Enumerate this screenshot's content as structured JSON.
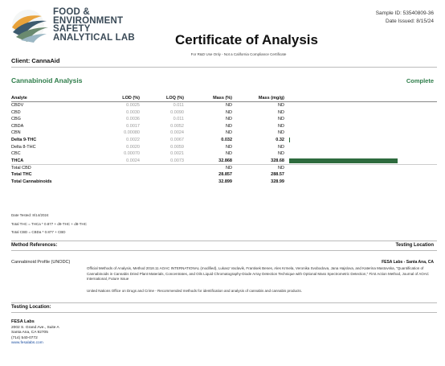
{
  "header": {
    "lab_name_lines": [
      "FOOD &",
      "ENVIRONMENT",
      "SAFETY",
      "ANALYTICAL LAB"
    ],
    "sample_id": "Sample ID: 53540809-36",
    "date_issued": "Date Issued: 8/15/24",
    "title": "Certificate of Analysis",
    "disclaimer": "For R&D Use Only - Not a California Compliance Certificate"
  },
  "client": "Client: CannaAid",
  "section": {
    "title": "Cannabinoid Analysis",
    "status": "Complete"
  },
  "table": {
    "headers": {
      "analyte": "Analyte",
      "lod": "LOD (%)",
      "loq": "LOQ (%)",
      "mass_pct": "Mass (%)",
      "mass_mg": "Mass (mg/g)"
    },
    "rows": [
      {
        "analyte": "CBDV",
        "lod": "0.0025",
        "loq": "0.011",
        "pct": "ND",
        "mg": "ND"
      },
      {
        "analyte": "CBD",
        "lod": "0.0030",
        "loq": "0.0090",
        "pct": "ND",
        "mg": "ND"
      },
      {
        "analyte": "CBG",
        "lod": "0.0036",
        "loq": "0.011",
        "pct": "ND",
        "mg": "ND"
      },
      {
        "analyte": "CBDA",
        "lod": "0.0017",
        "loq": "0.0052",
        "pct": "ND",
        "mg": "ND"
      },
      {
        "analyte": "CBN",
        "lod": "0.00080",
        "loq": "0.0024",
        "pct": "ND",
        "mg": "ND"
      },
      {
        "analyte": "Delta 9-THC",
        "lod": "0.0022",
        "loq": "0.0067",
        "pct": "0.032",
        "mg": "0.32",
        "bold": true
      },
      {
        "analyte": "Delta 8-THC",
        "lod": "0.0020",
        "loq": "0.0059",
        "pct": "ND",
        "mg": "ND"
      },
      {
        "analyte": "CBC",
        "lod": "0.00070",
        "loq": "0.0021",
        "pct": "ND",
        "mg": "ND"
      },
      {
        "analyte": "THCA",
        "lod": "0.0024",
        "loq": "0.0073",
        "pct": "32.868",
        "mg": "328.68",
        "bold": true
      },
      {
        "analyte": "Total CBD",
        "lod": "",
        "loq": "",
        "pct": "ND",
        "mg": "ND"
      },
      {
        "analyte": "Total THC",
        "lod": "",
        "loq": "",
        "pct": "28.857",
        "mg": "288.57",
        "bold": true
      },
      {
        "analyte": "Total Cannabinoids",
        "lod": "",
        "loq": "",
        "pct": "32.899",
        "mg": "328.99",
        "bold": true
      }
    ],
    "bar_color": "#2e6b3e",
    "bar_max_mg": 328.68
  },
  "footnotes": [
    "Date Tested: 8/14/2024",
    "Total THC = THCa * 0.877 + d9-THC + d8-THC",
    "Total CBD = CBDa * 0.877 + CBD"
  ],
  "method": {
    "heading": "Method References:",
    "heading_right": "Testing Location",
    "name": "Cannabinoid Profile (UNODC)",
    "lab": "FESA Labs - Santa Ana, CA",
    "ref1": "Official Methods of Analysis, Method 2018.11 AOAC INTERNATIONAL (modified), Lukasz Vaclavik, Frantisek Benes, Ales Krmela, Veronika Svobodova, Jana Hajslova, and Katerina Mastovska, \"Quantification of Cannabinoids in Cannabis Dried Plant Materials, Concentrates, and Oils Liquid Chromatography-Diode Array Detection Technique with Optional Mass Spectrometric Detection,\" First Action Method, Journal of AOAC International, Future Issue",
    "ref2": "United Nations Office on Drugs and Crime - Recommended methods for identification and analysis of cannabis and cannabis products."
  },
  "testing_location": {
    "heading": "Testing Location:",
    "name": "FESA Labs",
    "address1": "2002 S. Grand Ave., Suite A",
    "address2": "Santa Ana, CA 92705",
    "phone": "(714) 540-0772",
    "website": "www.fesalabs.com"
  }
}
